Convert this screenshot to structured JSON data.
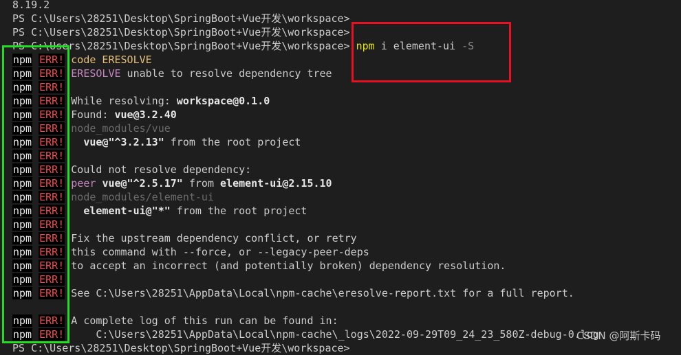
{
  "terminal": {
    "version_line": "8.19.2",
    "prompt": "PS C:\\Users\\28251\\Desktop\\SpringBoot+Vue开发\\workspace>",
    "command": {
      "npm": "npm",
      "rest": " i element-ui ",
      "flag": "-S"
    },
    "npm_label": "npm",
    "err_label": "ERR!",
    "messages": [
      {
        "kind": "code",
        "text": "code ERESOLVE"
      },
      {
        "kind": "eresolve",
        "a": "ERESOLVE",
        "b": " unable to resolve dependency tree"
      },
      {
        "kind": "blank"
      },
      {
        "kind": "resolving",
        "a": "While resolving: ",
        "b": "workspace@0.1.0"
      },
      {
        "kind": "found",
        "a": "Found: ",
        "b": "vue@3.2.40"
      },
      {
        "kind": "dim",
        "text": "node_modules/vue"
      },
      {
        "kind": "vue",
        "a": "  vue@\"^3.2.13\"",
        "b": " from the root project"
      },
      {
        "kind": "blank"
      },
      {
        "kind": "plain",
        "text": "Could not resolve dependency:"
      },
      {
        "kind": "peer",
        "a": "peer ",
        "b": "vue@\"^2.5.17\"",
        "c": " from ",
        "d": "element-ui@2.15.10"
      },
      {
        "kind": "dim",
        "text": "node_modules/element-ui"
      },
      {
        "kind": "vue",
        "a": "  element-ui@\"*\"",
        "b": " from the root project"
      },
      {
        "kind": "blank"
      },
      {
        "kind": "plain",
        "text": "Fix the upstream dependency conflict, or retry"
      },
      {
        "kind": "plain",
        "text": "this command with --force, or --legacy-peer-deps"
      },
      {
        "kind": "plain",
        "text": "to accept an incorrect (and potentially broken) dependency resolution."
      },
      {
        "kind": "blank"
      },
      {
        "kind": "plain",
        "text": "See C:\\Users\\28251\\AppData\\Local\\npm-cache\\eresolve-report.txt for a full report."
      }
    ],
    "log_line_1": "A complete log of this run can be found in:",
    "log_line_2": "    C:\\Users\\28251\\AppData\\Local\\npm-cache\\_logs\\2022-09-29T09_24_23_580Z-debug-0.log",
    "bottom_prompt": "PS C:\\Users\\28251\\Desktop\\SpringBoot+Vue开发\\workspace>"
  },
  "watermark": "CSDN @阿斯卡码"
}
